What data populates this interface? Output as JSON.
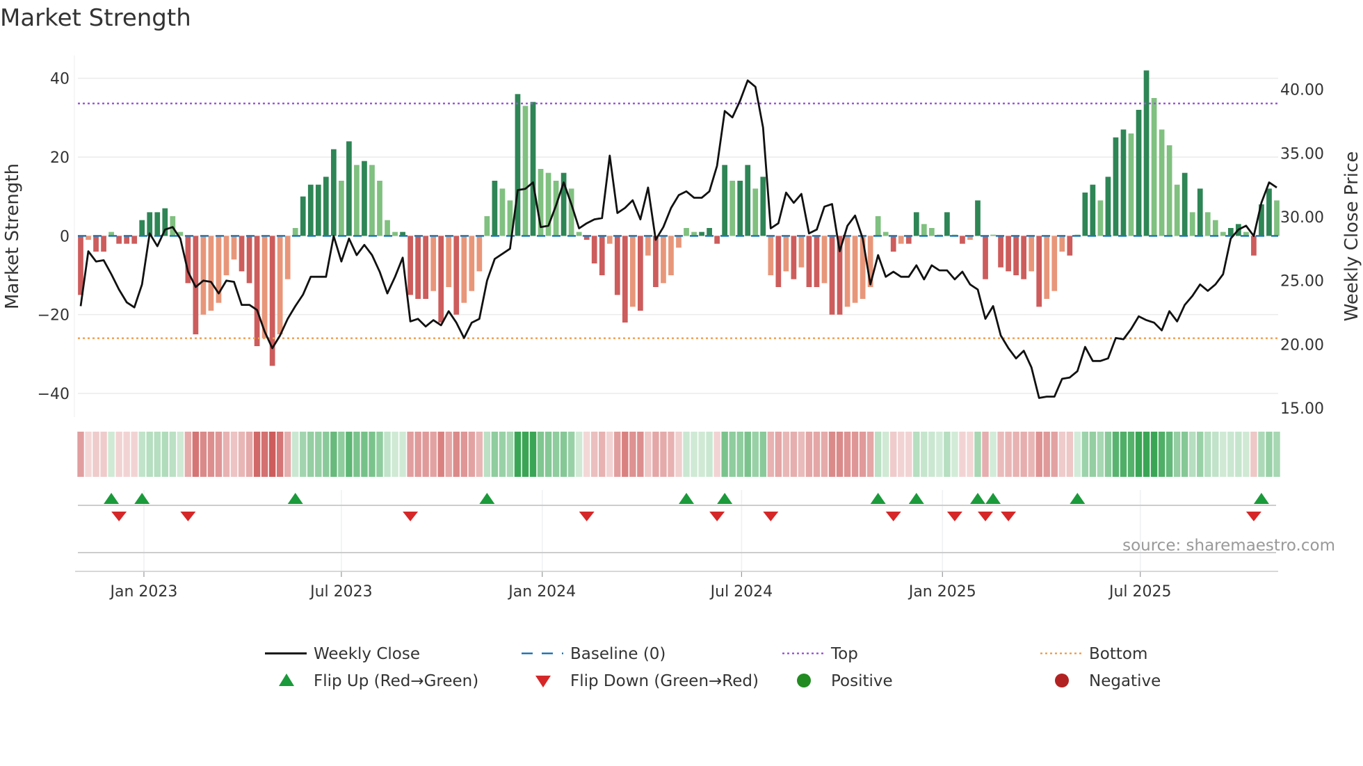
{
  "title": "Market Strength",
  "source": "source: sharemaestro.com",
  "colors": {
    "pos_dark": "#2e8555",
    "pos_light": "#80c080",
    "neg_dark": "#cd5c5c",
    "neg_light": "#e8967a",
    "line": "#111111",
    "baseline": "#1f77b4",
    "top": "#9b59d6",
    "bottom": "#f0a050",
    "flip_up": "#1a9a3a",
    "flip_down": "#d62728",
    "positive": "#228b22",
    "negative": "#b22222"
  },
  "chart_data": {
    "type": "bar",
    "title": "Market Strength",
    "ylabel": "Market Strength",
    "y2label": "Weekly Close Price",
    "ylim": [
      -46,
      44
    ],
    "y2lim": [
      14.3,
      42.1
    ],
    "yticks": [
      {
        "v": 40,
        "label": "40"
      },
      {
        "v": 20,
        "label": "20"
      },
      {
        "v": 0,
        "label": "0"
      },
      {
        "v": -20,
        "label": "−20"
      },
      {
        "v": -40,
        "label": "−40"
      }
    ],
    "y2ticks": [
      {
        "v": 40,
        "label": "40.00"
      },
      {
        "v": 35,
        "label": "35.00"
      },
      {
        "v": 30,
        "label": "30.00"
      },
      {
        "v": 25,
        "label": "25.00"
      },
      {
        "v": 20,
        "label": "20.00"
      },
      {
        "v": 15,
        "label": "15.00"
      }
    ],
    "xticks": [
      {
        "week": 8.25,
        "label": "Jan 2023"
      },
      {
        "week": 34.0,
        "label": "Jul 2023"
      },
      {
        "week": 60.2,
        "label": "Jan 2024"
      },
      {
        "week": 86.2,
        "label": "Jul 2024"
      },
      {
        "week": 112.4,
        "label": "Jan 2025"
      },
      {
        "week": 138.2,
        "label": "Jul 2025"
      }
    ],
    "top": 33.6,
    "bottom": -26,
    "baseline": 0,
    "strength": [
      -15,
      -1,
      -4,
      -4,
      1,
      -2,
      -2,
      -2,
      4,
      6,
      6,
      7,
      5,
      1,
      -12,
      -25,
      -20,
      -19,
      -17,
      -10,
      -6,
      -9,
      -12,
      -28,
      -26,
      -33,
      -25,
      -11,
      2,
      10,
      13,
      13,
      15,
      22,
      14,
      24,
      18,
      19,
      18,
      14,
      4,
      1,
      1,
      -15,
      -16,
      -16,
      -14,
      -22,
      -13,
      -20,
      -17,
      -14,
      -9,
      5,
      14,
      12,
      9,
      36,
      33,
      34,
      17,
      16,
      14,
      16,
      12,
      1,
      -1,
      -7,
      -10,
      -2,
      -15,
      -22,
      -18,
      -19,
      -5,
      -13,
      -12,
      -10,
      -3,
      2,
      1,
      1,
      2,
      -2,
      18,
      14,
      14,
      18,
      12,
      15,
      -10,
      -13,
      -9,
      -11,
      -8,
      -13,
      -13,
      -12,
      -20,
      -20,
      -18,
      -17,
      -16,
      -13,
      5,
      1,
      -4,
      -2,
      -2,
      6,
      3,
      2,
      0.3,
      6,
      0.3,
      -2,
      -1,
      9,
      -11,
      0.3,
      -8,
      -9,
      -10,
      -11,
      -9,
      -18,
      -16,
      -14,
      -4,
      -5,
      0.3,
      11,
      13,
      9,
      15,
      25,
      27,
      26,
      32,
      42,
      35,
      27,
      23,
      13,
      16,
      6,
      12,
      6,
      4,
      1,
      2,
      3,
      1,
      -5,
      8,
      12,
      9
    ],
    "close": [
      23.0,
      27.3,
      26.5,
      26.6,
      25.5,
      24.3,
      23.3,
      22.9,
      24.7,
      28.7,
      27.7,
      29.0,
      29.2,
      28.3,
      25.7,
      24.5,
      25.0,
      24.9,
      24.0,
      25.0,
      24.9,
      23.1,
      23.1,
      22.7,
      21.0,
      19.7,
      20.7,
      22.0,
      23.0,
      23.9,
      25.3,
      25.3,
      25.3,
      28.5,
      26.5,
      28.3,
      27.0,
      27.8,
      27.0,
      25.7,
      24.0,
      25.3,
      26.8,
      21.8,
      22.0,
      21.4,
      21.9,
      21.5,
      22.6,
      21.7,
      20.5,
      21.7,
      22.0,
      25.0,
      26.7,
      27.1,
      27.5,
      32.1,
      32.2,
      32.7,
      29.2,
      29.3,
      30.9,
      32.7,
      31.0,
      29.1,
      29.5,
      29.8,
      29.9,
      34.8,
      30.3,
      30.7,
      31.3,
      29.8,
      32.3,
      28.2,
      29.2,
      30.7,
      31.7,
      32.0,
      31.5,
      31.5,
      32.0,
      34.0,
      38.3,
      37.8,
      39.1,
      40.7,
      40.2,
      37.0,
      29.1,
      29.5,
      31.9,
      31.1,
      31.8,
      28.7,
      29.0,
      30.8,
      31.0,
      27.3,
      29.3,
      30.1,
      28.3,
      24.7,
      27.0,
      25.3,
      25.7,
      25.3,
      25.3,
      26.2,
      25.1,
      26.2,
      25.8,
      25.8,
      25.1,
      25.7,
      24.7,
      24.3,
      22.0,
      23.0,
      20.7,
      19.7,
      18.9,
      19.5,
      18.2,
      15.8,
      15.9,
      15.9,
      17.3,
      17.4,
      17.9,
      19.8,
      18.7,
      18.7,
      18.9,
      20.5,
      20.4,
      21.2,
      22.2,
      21.9,
      21.7,
      21.1,
      22.6,
      21.8,
      23.1,
      23.8,
      24.7,
      24.2,
      24.7,
      25.5,
      28.3,
      29.0,
      29.3,
      28.5,
      31.1,
      32.7,
      32.3
    ],
    "flip_up_weeks": [
      4,
      8,
      28,
      53,
      79,
      84,
      104,
      109,
      117,
      119,
      130,
      154
    ],
    "flip_down_weeks": [
      5,
      14,
      43,
      66,
      83,
      90,
      106,
      114,
      118,
      121,
      153
    ],
    "legend": [
      {
        "key": "line",
        "label": "Weekly Close"
      },
      {
        "key": "baseline",
        "label": "Baseline (0)"
      },
      {
        "key": "top",
        "label": "Top"
      },
      {
        "key": "bottom",
        "label": "Bottom"
      },
      {
        "key": "flip_up",
        "label": "Flip Up (Red→Green)"
      },
      {
        "key": "flip_down",
        "label": "Flip Down (Green→Red)"
      },
      {
        "key": "positive",
        "label": "Positive"
      },
      {
        "key": "negative",
        "label": "Negative"
      }
    ],
    "legend_position": "bottom"
  }
}
